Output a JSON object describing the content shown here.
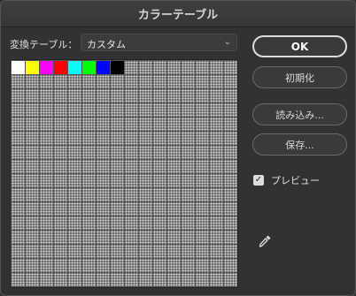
{
  "window": {
    "title": "カラーテーブル"
  },
  "table": {
    "label": "変換テーブル：",
    "selected": "カスタム"
  },
  "swatches": [
    "#ffffff",
    "#ffff00",
    "#ff00ff",
    "#ff0000",
    "#00ffff",
    "#00ff00",
    "#0000ff",
    "#000000"
  ],
  "buttons": {
    "ok": "OK",
    "reset": "初期化",
    "load": "読み込み...",
    "save": "保存..."
  },
  "preview": {
    "label": "プレビュー",
    "checked": true
  },
  "icons": {
    "dropdown": "chevron-down-icon",
    "checkbox": "checkmark-icon",
    "tool": "eyedropper-icon"
  }
}
